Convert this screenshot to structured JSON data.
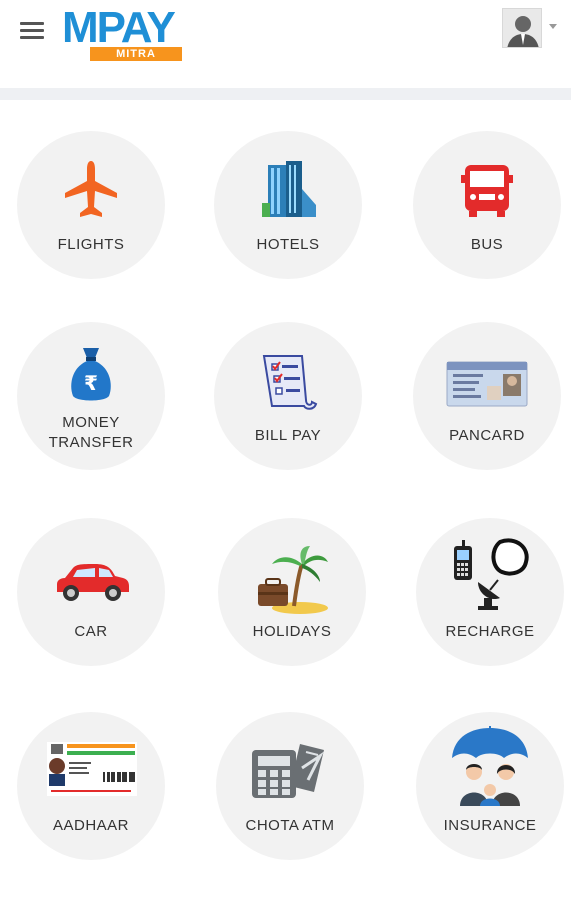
{
  "header": {
    "logo_main_m": "M",
    "logo_main_pay": "PAY",
    "logo_sub": "MITRA",
    "menu_icon": "hamburger-menu-icon",
    "avatar_icon": "user-avatar-icon",
    "caret_icon": "chevron-down-icon"
  },
  "colors": {
    "brand_blue": "#1f8fd6",
    "brand_orange": "#f7941d",
    "tile_bg": "#f2f2f2"
  },
  "services": [
    {
      "label": "FLIGHTS",
      "icon": "airplane-icon"
    },
    {
      "label": "HOTELS",
      "icon": "hotel-building-icon"
    },
    {
      "label": "BUS",
      "icon": "bus-icon"
    },
    {
      "label_line1": "MONEY",
      "label_line2": "TRANSFER",
      "icon": "money-bag-icon"
    },
    {
      "label": "BILL PAY",
      "icon": "bill-checklist-icon"
    },
    {
      "label": "PANCARD",
      "icon": "pan-card-icon"
    },
    {
      "label": "CAR",
      "icon": "car-icon"
    },
    {
      "label": "HOLIDAYS",
      "icon": "palm-tree-luggage-icon"
    },
    {
      "label": "RECHARGE",
      "icon": "phone-dish-icon"
    },
    {
      "label": "AADHAAR",
      "icon": "aadhaar-card-icon"
    },
    {
      "label": "CHOTA ATM",
      "icon": "calculator-card-icon"
    },
    {
      "label": "INSURANCE",
      "icon": "umbrella-family-icon"
    }
  ]
}
